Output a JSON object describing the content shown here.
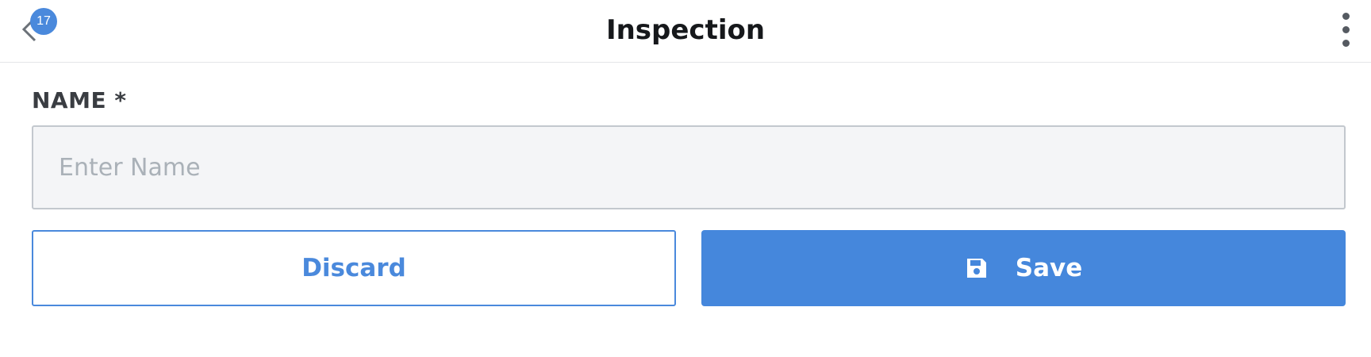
{
  "header": {
    "title": "Inspection",
    "back_badge": "17"
  },
  "form": {
    "name_label": "NAME *",
    "name_placeholder": "Enter Name",
    "name_value": ""
  },
  "actions": {
    "discard_label": "Discard",
    "save_label": "Save"
  },
  "icons": {
    "back": "chevron-left-icon",
    "more": "more-vertical-icon",
    "save": "floppy-disk-icon"
  },
  "colors": {
    "accent": "#4a89dc",
    "input_bg": "#f4f5f7",
    "input_border": "#c3c8ce",
    "title_text": "#16181b"
  }
}
